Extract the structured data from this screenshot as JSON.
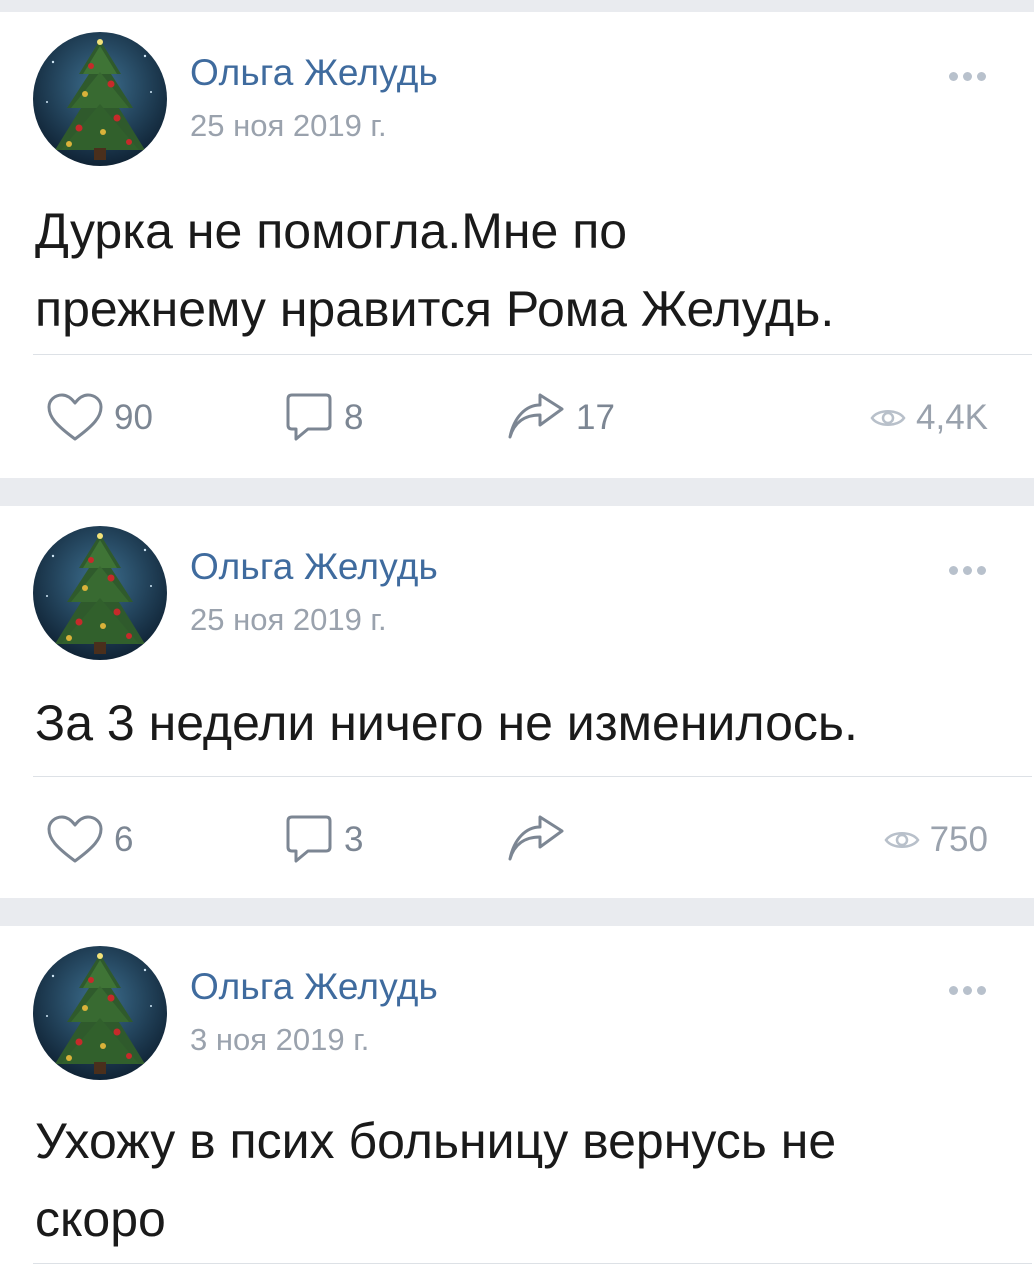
{
  "posts": [
    {
      "author": "Ольга Желудь",
      "date": "25 ноя 2019 г.",
      "text": "Дурка не помогла.Мне по\nпрежнему нравится Рома Желудь.",
      "likes": "90",
      "comments": "8",
      "shares": "17",
      "views": "4,4K"
    },
    {
      "author": "Ольга Желудь",
      "date": "25 ноя 2019 г.",
      "text": "За 3 недели ничего не изменилось.",
      "likes": "6",
      "comments": "3",
      "shares": "",
      "views": "750"
    },
    {
      "author": "Ольга Желудь",
      "date": "3 ноя 2019 г.",
      "text": "Ухожу в псих больницу вернусь не\nскоро",
      "likes": "",
      "comments": "",
      "shares": "",
      "views": ""
    }
  ],
  "icons": {
    "like": "heart-icon",
    "comment": "comment-icon",
    "share": "share-icon",
    "views": "eye-icon",
    "more": "more-dots-icon",
    "avatar": "christmas-tree-avatar"
  },
  "colors": {
    "author_link": "#3f6b9e",
    "muted": "#9aa2ad",
    "icon": "#7c8693",
    "feed_bg": "#e9ebef"
  }
}
